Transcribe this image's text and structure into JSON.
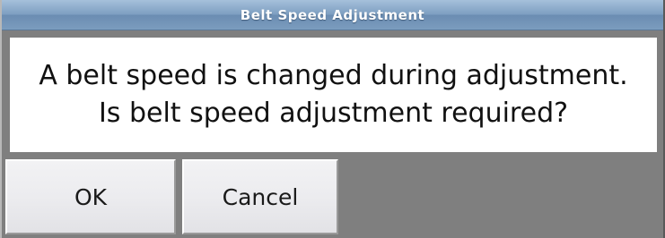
{
  "dialog": {
    "title": "Belt Speed Adjustment",
    "message_line_1": "A belt speed is changed during adjustment.",
    "message_line_2": "Is belt speed adjustment required?",
    "ok_label": "OK",
    "cancel_label": "Cancel"
  },
  "colors": {
    "titlebar": "#7e9fc1",
    "background": "#7f7f7f",
    "panel": "#ffffff",
    "button": "#ececef"
  }
}
